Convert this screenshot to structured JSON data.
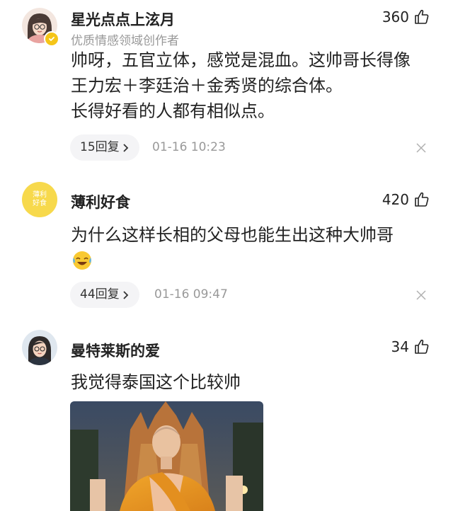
{
  "comments": [
    {
      "username": "星光点点上泫月",
      "subtitle": "优质情感领域创作者",
      "likes": "360",
      "lines": [
        "帅呀，五官立体，感觉是混血。这帅哥长得像",
        "王力宏＋李廷治＋金秀贤的综合体。",
        "长得好看的人都有相似点。"
      ],
      "replies": "15回复",
      "time": "01-16 10:23",
      "avatar_icon": "female-avatar-icon",
      "badge_icon": "verified-check-icon"
    },
    {
      "username": "薄利好食",
      "avatar_text": [
        "薄利",
        "好食"
      ],
      "likes": "420",
      "lines": [
        "为什么这样长相的父母也能生出这种大帅哥"
      ],
      "emoji_icon": "crying-laughing-emoji-icon",
      "replies": "44回复",
      "time": "01-16 09:47"
    },
    {
      "username": "曼特莱斯的爱",
      "likes": "34",
      "lines": [
        "我觉得泰国这个比较帅"
      ],
      "avatar_icon": "female-avatar-icon",
      "photo_icon": "monk-photo-icon"
    }
  ],
  "colors": {
    "text": "#222222",
    "muted": "#999999",
    "pill_bg": "#f4f4f6",
    "badge": "#f5c518",
    "avatar2_bg": "#f7d94c"
  }
}
